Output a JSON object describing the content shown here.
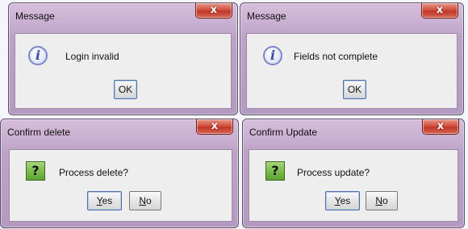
{
  "dialogs": [
    {
      "title": "Message",
      "close_label": "x",
      "icon": "info-icon",
      "message": "Login invalid",
      "buttons": [
        "OK"
      ]
    },
    {
      "title": "Message",
      "close_label": "x",
      "icon": "info-icon",
      "message": "Fields not complete",
      "buttons": [
        "OK"
      ]
    },
    {
      "title": "Confirm delete",
      "close_label": "x",
      "icon": "question-icon",
      "message": "Process delete?",
      "buttons": [
        {
          "mnemonic": "Y",
          "rest": "es"
        },
        {
          "mnemonic": "N",
          "rest": "o"
        }
      ]
    },
    {
      "title": "Confirm Update",
      "close_label": "x",
      "icon": "question-icon",
      "message": "Process update?",
      "buttons": [
        {
          "mnemonic": "Y",
          "rest": "es"
        },
        {
          "mnemonic": "N",
          "rest": "o"
        }
      ]
    }
  ],
  "icon_glyphs": {
    "info": "i",
    "question": "?"
  },
  "colors": {
    "title_gradient_top": "#d7bfdc",
    "title_gradient_bottom": "#b49ac0",
    "close_red": "#c0392b",
    "content_bg": "#eeeeee"
  }
}
